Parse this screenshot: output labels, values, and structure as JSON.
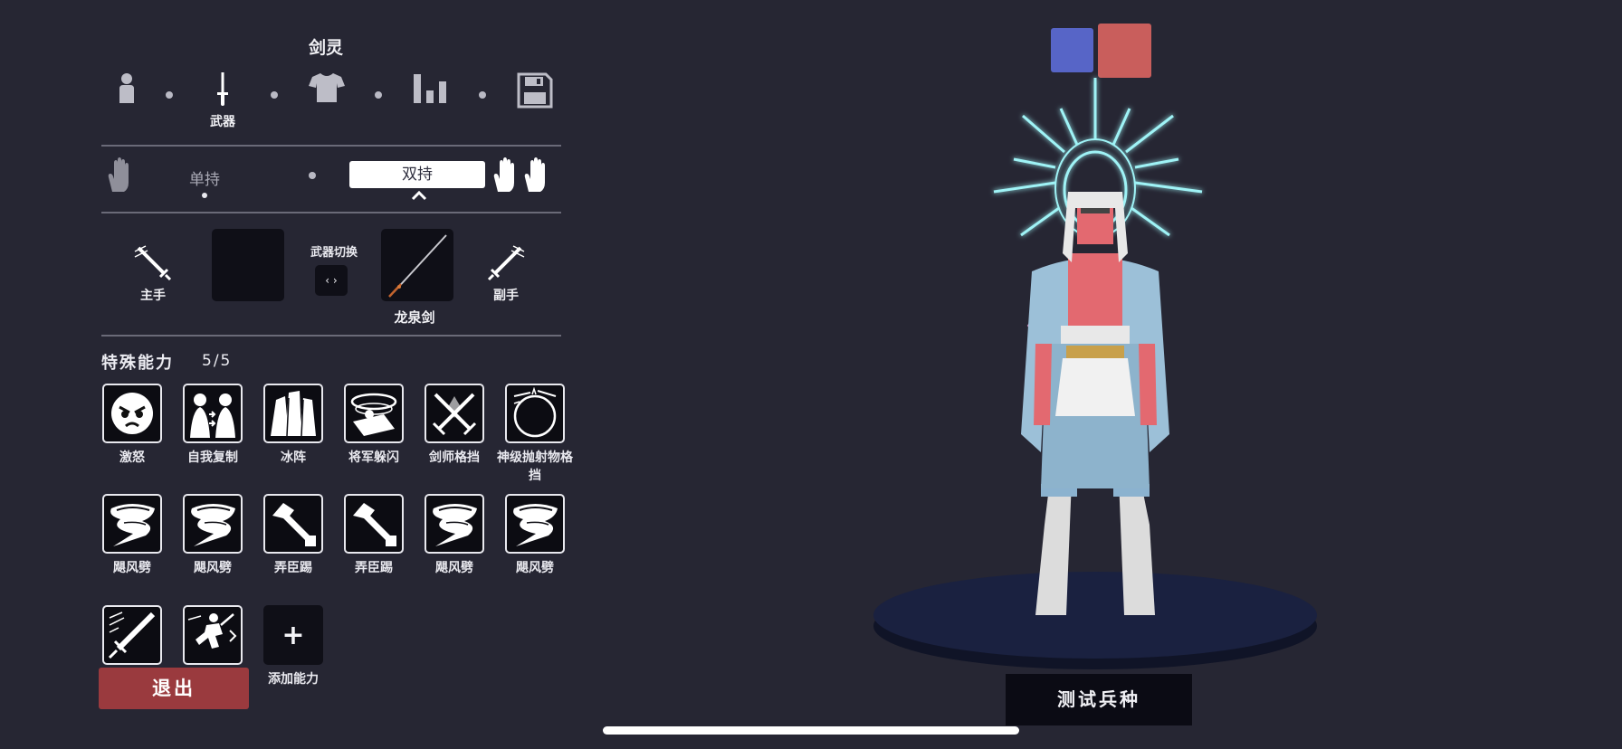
{
  "header": {
    "unit_name": "剑灵"
  },
  "steps": [
    {
      "id": "body",
      "label": "",
      "icon": "person-icon"
    },
    {
      "id": "weapon",
      "label": "武器",
      "icon": "sword-icon",
      "active": true
    },
    {
      "id": "clothes",
      "label": "",
      "icon": "shirt-icon"
    },
    {
      "id": "stats",
      "label": "",
      "icon": "bar-chart-icon"
    },
    {
      "id": "save",
      "label": "",
      "icon": "save-icon"
    }
  ],
  "grip": {
    "single_label": "单持",
    "dual_label": "双持",
    "selected": "双持"
  },
  "weapons": {
    "main_hand_label": "主手",
    "off_hand_label": "副手",
    "swap_label": "武器切换",
    "swap_button": "‹ ›",
    "off_hand_weapon": "龙泉剑"
  },
  "abilities": {
    "header": "特殊能力",
    "count": "5/5",
    "items": [
      {
        "name": "激怒",
        "icon": "angry-face-icon"
      },
      {
        "name": "自我复制",
        "icon": "self-clone-icon"
      },
      {
        "name": "冰阵",
        "icon": "ice-formation-icon"
      },
      {
        "name": "将军躲闪",
        "icon": "general-dodge-icon"
      },
      {
        "name": "剑师格挡",
        "icon": "crossed-swords-icon"
      },
      {
        "name": "神级抛射物格挡",
        "icon": "projectile-block-icon"
      },
      {
        "name": "飓风劈",
        "icon": "whirlwind-icon"
      },
      {
        "name": "飓风劈",
        "icon": "whirlwind-icon"
      },
      {
        "name": "弄臣踢",
        "icon": "hammer-icon"
      },
      {
        "name": "弄臣踢",
        "icon": "hammer-icon"
      },
      {
        "name": "飓风劈",
        "icon": "whirlwind-icon"
      },
      {
        "name": "飓风劈",
        "icon": "whirlwind-icon"
      },
      {
        "name": "",
        "icon": "sword-slash-icon"
      },
      {
        "name": "",
        "icon": "leap-attack-icon"
      }
    ],
    "add_label": "添加能力",
    "add_symbol": "+"
  },
  "footer": {
    "exit_label": "退出",
    "test_label": "测试兵种"
  },
  "colors": {
    "team_blue": "#5765c7",
    "team_red": "#c95e5c",
    "exit": "#9a3a3e"
  }
}
